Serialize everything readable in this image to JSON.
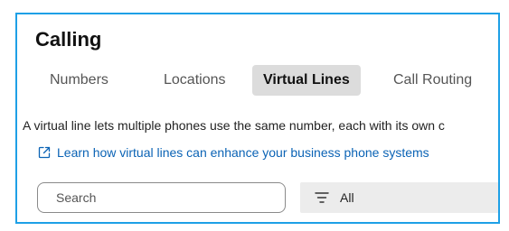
{
  "page": {
    "title": "Calling"
  },
  "tabs": [
    {
      "label": "Numbers",
      "active": false
    },
    {
      "label": "Locations",
      "active": false
    },
    {
      "label": "Virtual Lines",
      "active": true
    },
    {
      "label": "Call Routing",
      "active": false
    }
  ],
  "description": "A virtual line lets multiple phones use the same number, each with its own c",
  "learn_link": {
    "icon": "external-link-icon",
    "label": "Learn how virtual lines can enhance your business phone systems"
  },
  "search": {
    "placeholder": "Search",
    "value": ""
  },
  "filter": {
    "icon": "filter-icon",
    "selected": "All"
  },
  "colors": {
    "frame_border": "#1ea0e6",
    "link": "#0b63b5",
    "active_tab_bg": "#dcdcdc",
    "filter_bg": "#ececec"
  }
}
